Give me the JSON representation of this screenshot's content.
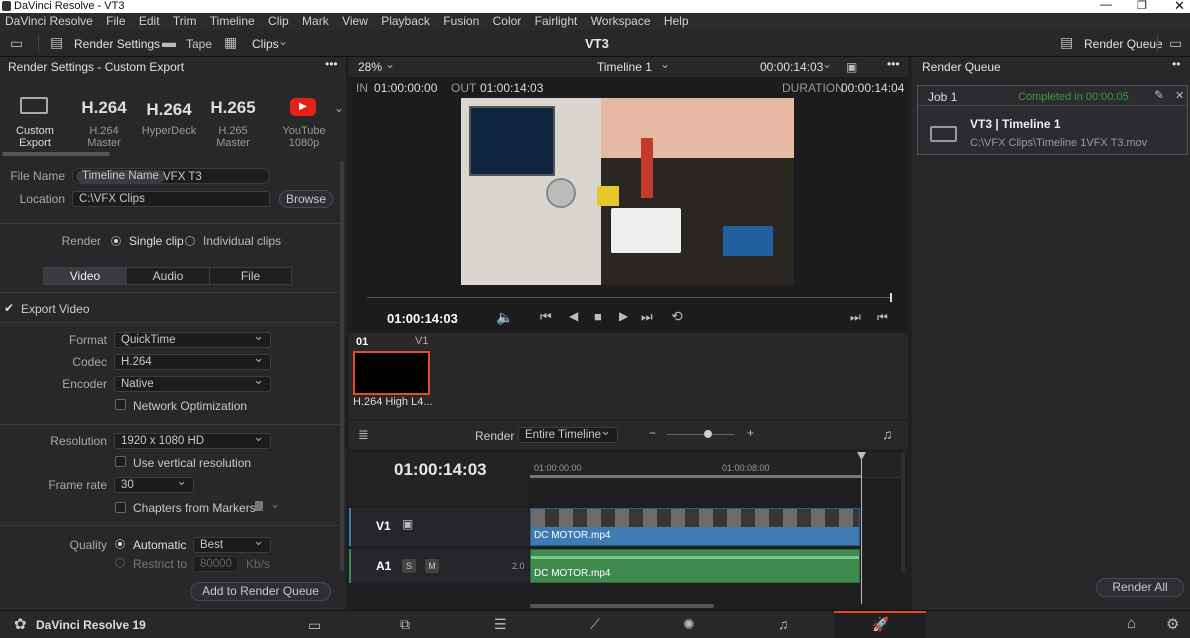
{
  "window": {
    "title": "DaVinci Resolve - VT3"
  },
  "menu": [
    "DaVinci Resolve",
    "File",
    "Edit",
    "Trim",
    "Timeline",
    "Clip",
    "Mark",
    "View",
    "Playback",
    "Fusion",
    "Color",
    "Fairlight",
    "Workspace",
    "Help"
  ],
  "toolbar": {
    "render_settings": "Render Settings",
    "tape": "Tape",
    "clips": "Clips",
    "project": "VT3",
    "render_queue": "Render Queue"
  },
  "left": {
    "title": "Render Settings - Custom Export",
    "presets": [
      {
        "big": "",
        "label": "Custom Export"
      },
      {
        "big": "H.264",
        "label": "H.264 Master"
      },
      {
        "big": "H.264",
        "label": "HyperDeck"
      },
      {
        "big": "H.265",
        "label": "H.265 Master"
      },
      {
        "big": "",
        "label": "YouTube 1080p"
      }
    ],
    "file_name_label": "File Name",
    "file_name_chip": "Timeline Name",
    "file_name_value": "VFX T3",
    "location_label": "Location",
    "location_value": "C:\\VFX Clips",
    "browse": "Browse",
    "render_label": "Render",
    "single_clip": "Single clip",
    "individual_clips": "Individual clips",
    "tabs": [
      "Video",
      "Audio",
      "File"
    ],
    "export_video": "Export Video",
    "format_label": "Format",
    "format_value": "QuickTime",
    "codec_label": "Codec",
    "codec_value": "H.264",
    "encoder_label": "Encoder",
    "encoder_value": "Native",
    "network_opt": "Network Optimization",
    "resolution_label": "Resolution",
    "resolution_value": "1920 x 1080 HD",
    "vertical_res": "Use vertical resolution",
    "framerate_label": "Frame rate",
    "framerate_value": "30",
    "chapters": "Chapters from Markers",
    "quality_label": "Quality",
    "automatic": "Automatic",
    "quality_value": "Best",
    "restrict": "Restrict to",
    "restrict_value": "80000",
    "restrict_unit": "Kb/s",
    "add_queue": "Add to Render Queue"
  },
  "viewer": {
    "zoom": "28%",
    "timeline": "Timeline 1",
    "tc_top": "00:00:14:03",
    "in_label": "IN",
    "in_tc": "01:00:00:00",
    "out_label": "OUT",
    "out_tc": "01:00:14:03",
    "duration_label": "DURATION",
    "duration_tc": "00:00:14:04",
    "playhead_tc": "01:00:14:03"
  },
  "clip": {
    "index": "01",
    "track": "V1",
    "name": "H.264 High L4..."
  },
  "timeline": {
    "render_label": "Render",
    "render_value": "Entire Timeline",
    "tc": "01:00:14:03",
    "ruler": [
      "01:00:00:00",
      "01:00:08:00"
    ],
    "v1": "V1",
    "a1": "A1",
    "a1_level": "2.0",
    "video_clip": "DC MOTOR.mp4",
    "audio_clip": "DC MOTOR.mp4"
  },
  "queue": {
    "title": "Render Queue",
    "job": "Job 1",
    "status": "Completed in 00:00:05",
    "job_title": "VT3 | Timeline 1",
    "job_path": "C:\\VFX Clips\\Timeline 1VFX T3.mov",
    "render_all": "Render All"
  },
  "footer": {
    "app": "DaVinci Resolve 19"
  },
  "colors": {
    "accent": "#e34c2b",
    "video_clip": "#3e7ab3",
    "audio_clip": "#3f8a4f",
    "completed": "#3c9a3c"
  }
}
